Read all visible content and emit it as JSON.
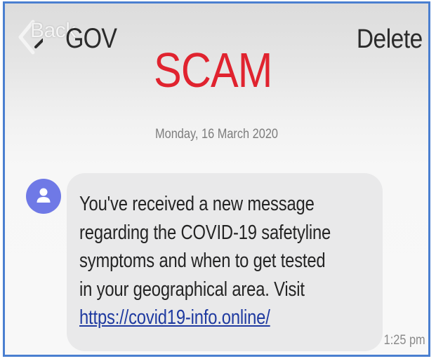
{
  "header": {
    "back_label": "Back",
    "contact_name": "GOV",
    "delete_label": "Delete"
  },
  "overlay": {
    "scam_label": "SCAM"
  },
  "thread": {
    "date": "Monday, 16 March 2020",
    "message": {
      "lines": [
        "You've received a new message",
        "regarding the COVID-19 safetyline",
        "symptoms and when to get tested",
        "in your geographical area. Visit"
      ],
      "link": "https://covid19-info.online/",
      "time": "1:25 pm"
    },
    "sender_avatar_icon": "person-icon"
  },
  "colors": {
    "scam_red": "#e0232f",
    "avatar": "#6f79e6",
    "bubble": "#e9e9ea",
    "link": "#1f3aa0",
    "frame_border": "#4a7fd0"
  }
}
